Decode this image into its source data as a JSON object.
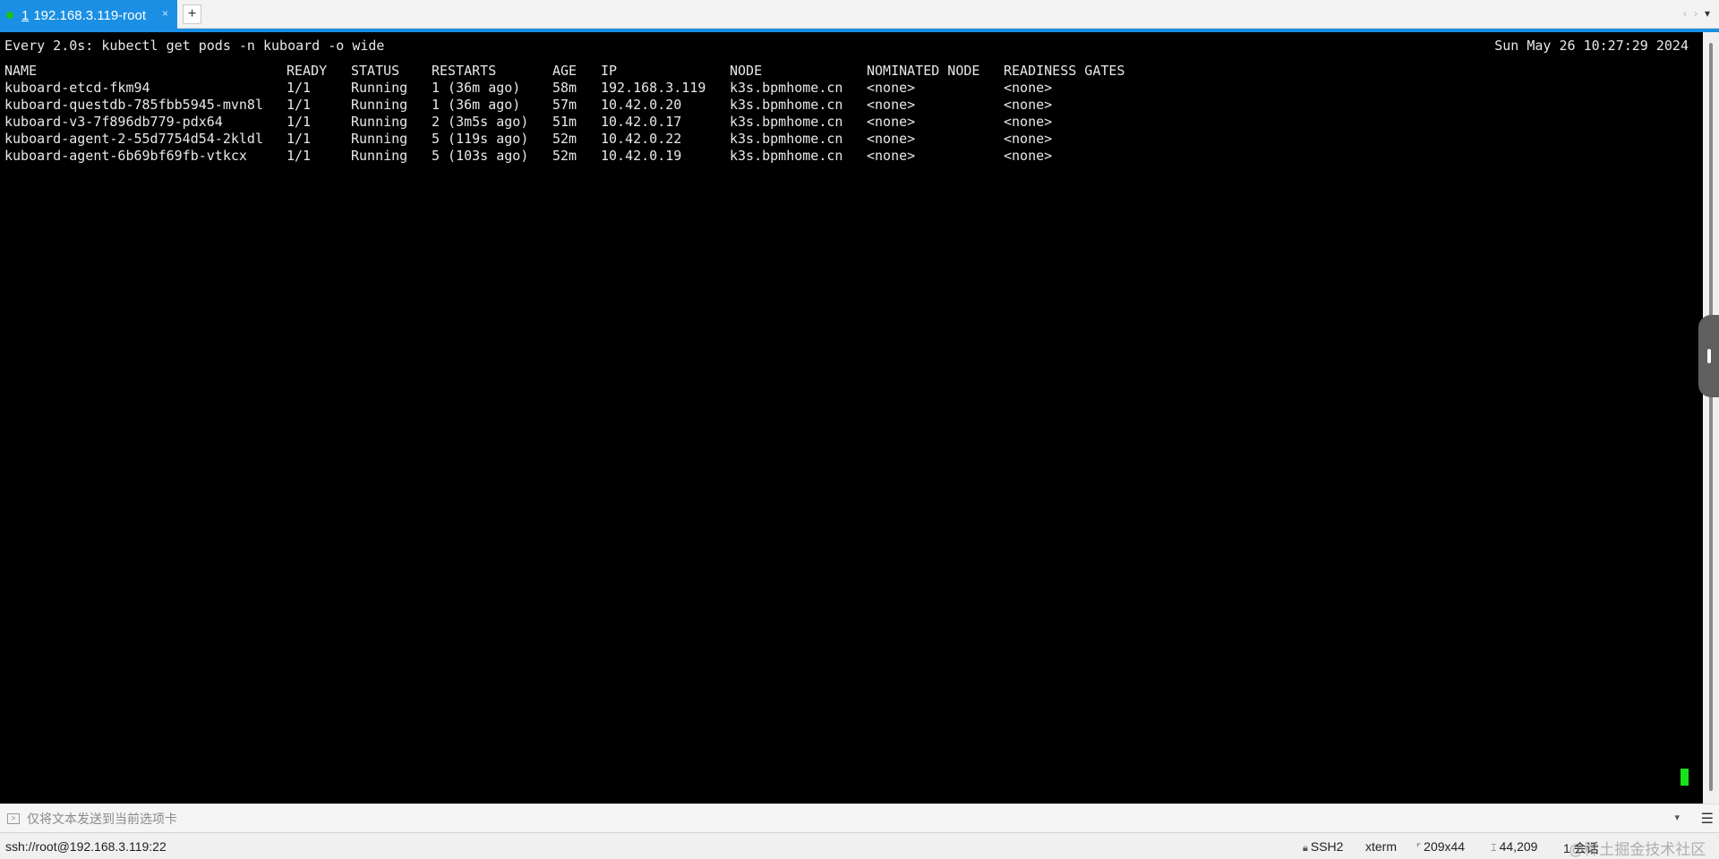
{
  "tab": {
    "number": "1",
    "title": "192.168.3.119-root",
    "close_glyph": "×",
    "new_tab_glyph": "+",
    "prev_glyph": "‹",
    "next_glyph": "›",
    "menu_glyph": "▾"
  },
  "terminal": {
    "command": "Every 2.0s: kubectl get pods -n kuboard -o wide",
    "clock": "Sun May 26 10:27:29 2024",
    "headers": [
      "NAME",
      "READY",
      "STATUS",
      "RESTARTS",
      "AGE",
      "IP",
      "NODE",
      "NOMINATED NODE",
      "READINESS GATES"
    ],
    "rows": [
      [
        "kuboard-etcd-fkm94",
        "1/1",
        "Running",
        "1 (36m ago)",
        "58m",
        "192.168.3.119",
        "k3s.bpmhome.cn",
        "<none>",
        "<none>"
      ],
      [
        "kuboard-questdb-785fbb5945-mvn8l",
        "1/1",
        "Running",
        "1 (36m ago)",
        "57m",
        "10.42.0.20",
        "k3s.bpmhome.cn",
        "<none>",
        "<none>"
      ],
      [
        "kuboard-v3-7f896db779-pdx64",
        "1/1",
        "Running",
        "2 (3m5s ago)",
        "51m",
        "10.42.0.17",
        "k3s.bpmhome.cn",
        "<none>",
        "<none>"
      ],
      [
        "kuboard-agent-2-55d7754d54-2kldl",
        "1/1",
        "Running",
        "5 (119s ago)",
        "52m",
        "10.42.0.22",
        "k3s.bpmhome.cn",
        "<none>",
        "<none>"
      ],
      [
        "kuboard-agent-6b69bf69fb-vtkcx",
        "1/1",
        "Running",
        "5 (103s ago)",
        "52m",
        "10.42.0.19",
        "k3s.bpmhome.cn",
        "<none>",
        "<none>"
      ]
    ]
  },
  "compose": {
    "placeholder": "仅将文本发送到当前选项卡",
    "dropdown_glyph": "▾",
    "menu_glyph": "☰"
  },
  "status": {
    "connection": "ssh://root@192.168.3.119:22",
    "protocol": "SSH2",
    "term_type": "xterm",
    "size": "209x44",
    "cursor_pos": "44,209",
    "sessions": "1 会话",
    "watermark": "@稀土掘金技术社区"
  },
  "colors": {
    "tab_accent": "#1a8fe3",
    "terminal_bg": "#000000",
    "terminal_fg": "#e8e8e8",
    "cursor": "#19e219"
  },
  "icons": {
    "status_dot": "green-status-dot-icon",
    "send": "send-text-icon",
    "lock": "lock-icon",
    "resize": "resize-icon",
    "position": "cursor-position-icon"
  }
}
